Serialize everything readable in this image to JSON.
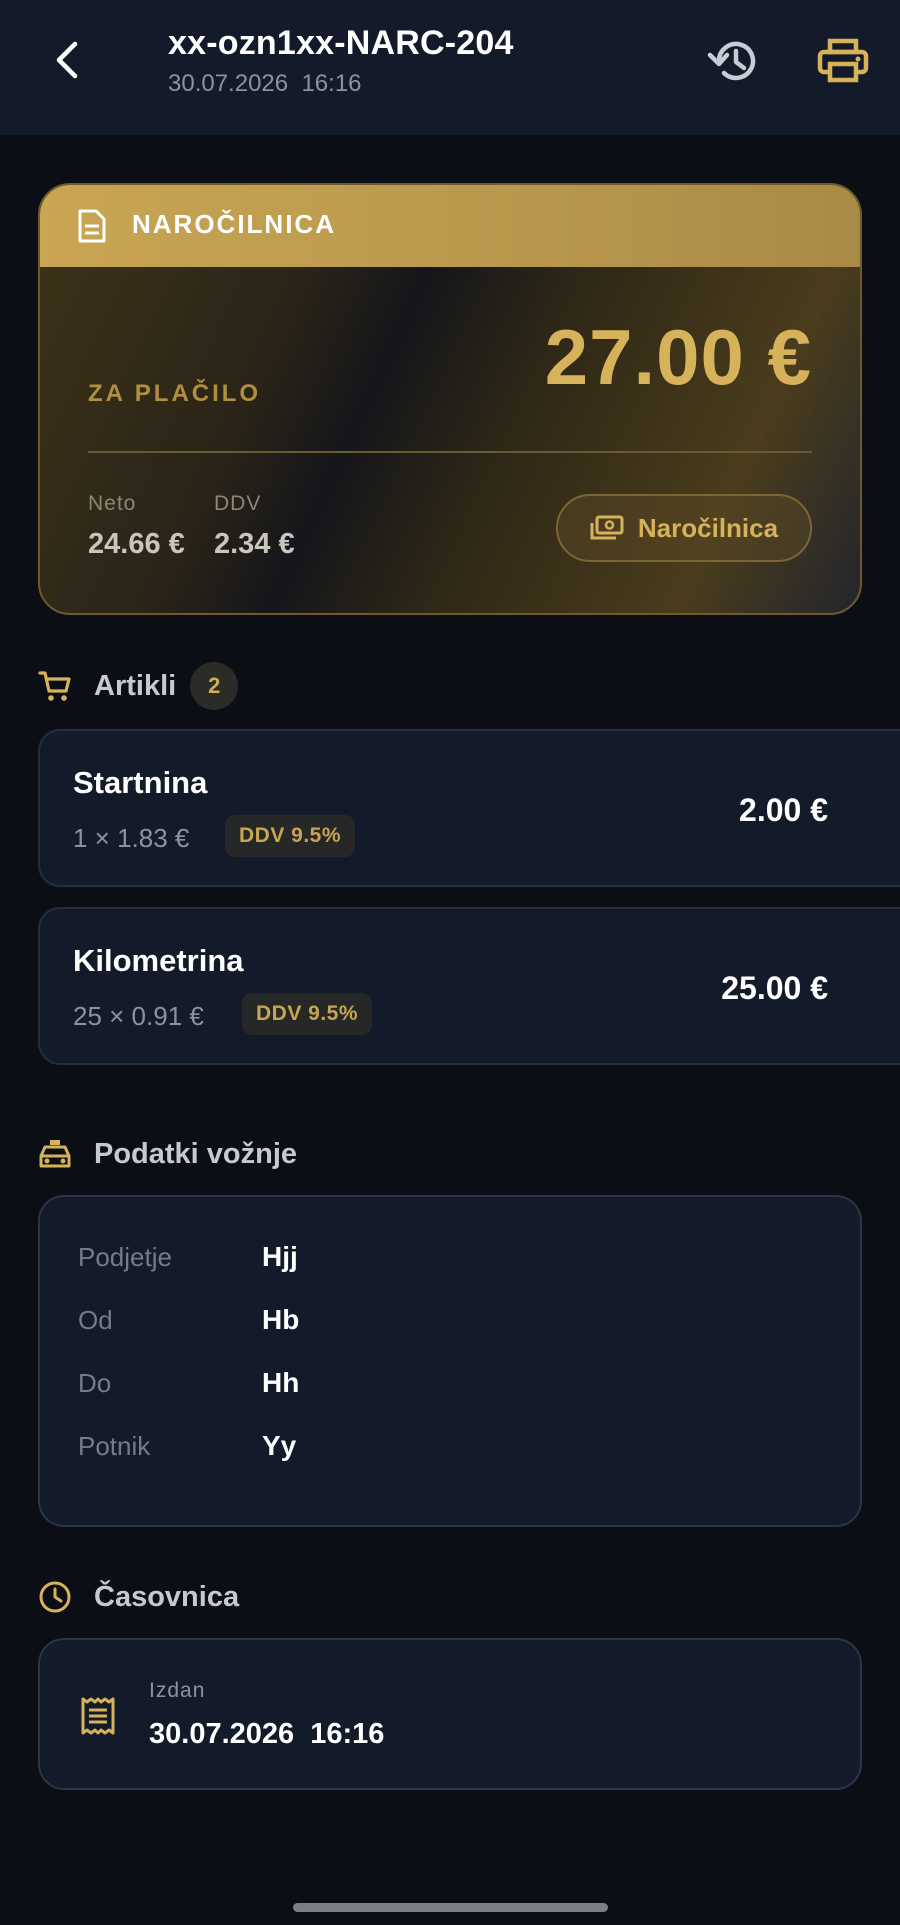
{
  "header": {
    "title": "xx-ozn1xx-NARC-204",
    "subtitle": "30.07.2026  16:16",
    "back_icon": "chevron-left-icon",
    "history_icon": "history-icon",
    "print_icon": "print-icon"
  },
  "summary": {
    "heading": "NAROČILNICA",
    "pay_label": "ZA PLAČILO",
    "total": "27.00 €",
    "neto_label": "Neto",
    "neto_value": "24.66 €",
    "ddv_label": "DDV",
    "ddv_value": "2.34 €",
    "order_button_label": "Naročilnica"
  },
  "items_section": {
    "title": "Artikli",
    "count": "2",
    "items": [
      {
        "name": "Startnina",
        "qty": "1 × 1.83 €",
        "vat": "DDV 9.5%",
        "price": "2.00 €"
      },
      {
        "name": "Kilometrina",
        "qty": "25 × 0.91 €",
        "vat": "DDV 9.5%",
        "price": "25.00 €"
      }
    ]
  },
  "ride_section": {
    "title": "Podatki vožnje",
    "rows": [
      {
        "label": "Podjetje",
        "value": "Hjj"
      },
      {
        "label": "Od",
        "value": "Hb"
      },
      {
        "label": "Do",
        "value": "Hh"
      },
      {
        "label": "Potnik",
        "value": "Yy"
      }
    ]
  },
  "timeline_section": {
    "title": "Časovnica",
    "issued_label": "Izdan",
    "issued_value": "30.07.2026  16:16"
  },
  "colors": {
    "accent_gold": "#d6b25a",
    "background": "#0b0e14",
    "card": "#131a2a"
  }
}
